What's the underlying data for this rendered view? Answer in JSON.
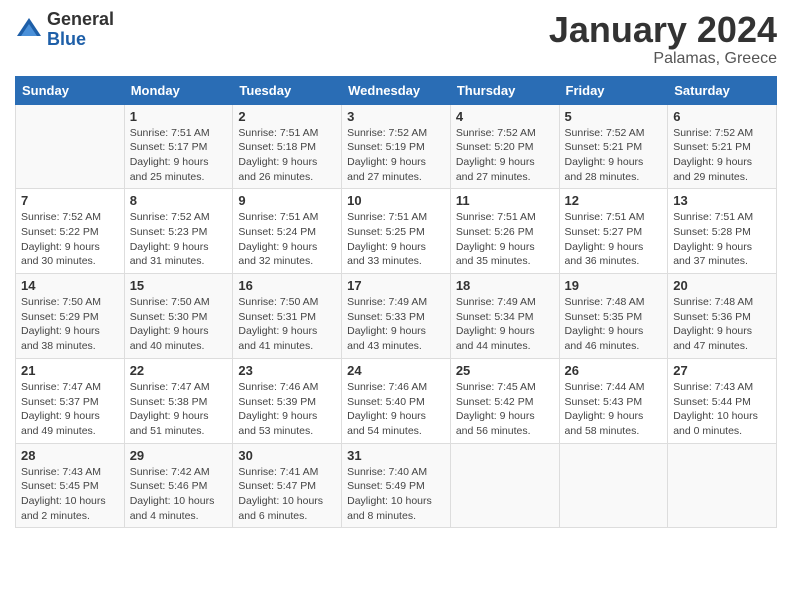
{
  "header": {
    "logo_general": "General",
    "logo_blue": "Blue",
    "month_title": "January 2024",
    "subtitle": "Palamas, Greece"
  },
  "days_of_week": [
    "Sunday",
    "Monday",
    "Tuesday",
    "Wednesday",
    "Thursday",
    "Friday",
    "Saturday"
  ],
  "weeks": [
    [
      {
        "day": "",
        "info": ""
      },
      {
        "day": "1",
        "info": "Sunrise: 7:51 AM\nSunset: 5:17 PM\nDaylight: 9 hours\nand 25 minutes."
      },
      {
        "day": "2",
        "info": "Sunrise: 7:51 AM\nSunset: 5:18 PM\nDaylight: 9 hours\nand 26 minutes."
      },
      {
        "day": "3",
        "info": "Sunrise: 7:52 AM\nSunset: 5:19 PM\nDaylight: 9 hours\nand 27 minutes."
      },
      {
        "day": "4",
        "info": "Sunrise: 7:52 AM\nSunset: 5:20 PM\nDaylight: 9 hours\nand 27 minutes."
      },
      {
        "day": "5",
        "info": "Sunrise: 7:52 AM\nSunset: 5:21 PM\nDaylight: 9 hours\nand 28 minutes."
      },
      {
        "day": "6",
        "info": "Sunrise: 7:52 AM\nSunset: 5:21 PM\nDaylight: 9 hours\nand 29 minutes."
      }
    ],
    [
      {
        "day": "7",
        "info": "Sunrise: 7:52 AM\nSunset: 5:22 PM\nDaylight: 9 hours\nand 30 minutes."
      },
      {
        "day": "8",
        "info": "Sunrise: 7:52 AM\nSunset: 5:23 PM\nDaylight: 9 hours\nand 31 minutes."
      },
      {
        "day": "9",
        "info": "Sunrise: 7:51 AM\nSunset: 5:24 PM\nDaylight: 9 hours\nand 32 minutes."
      },
      {
        "day": "10",
        "info": "Sunrise: 7:51 AM\nSunset: 5:25 PM\nDaylight: 9 hours\nand 33 minutes."
      },
      {
        "day": "11",
        "info": "Sunrise: 7:51 AM\nSunset: 5:26 PM\nDaylight: 9 hours\nand 35 minutes."
      },
      {
        "day": "12",
        "info": "Sunrise: 7:51 AM\nSunset: 5:27 PM\nDaylight: 9 hours\nand 36 minutes."
      },
      {
        "day": "13",
        "info": "Sunrise: 7:51 AM\nSunset: 5:28 PM\nDaylight: 9 hours\nand 37 minutes."
      }
    ],
    [
      {
        "day": "14",
        "info": "Sunrise: 7:50 AM\nSunset: 5:29 PM\nDaylight: 9 hours\nand 38 minutes."
      },
      {
        "day": "15",
        "info": "Sunrise: 7:50 AM\nSunset: 5:30 PM\nDaylight: 9 hours\nand 40 minutes."
      },
      {
        "day": "16",
        "info": "Sunrise: 7:50 AM\nSunset: 5:31 PM\nDaylight: 9 hours\nand 41 minutes."
      },
      {
        "day": "17",
        "info": "Sunrise: 7:49 AM\nSunset: 5:33 PM\nDaylight: 9 hours\nand 43 minutes."
      },
      {
        "day": "18",
        "info": "Sunrise: 7:49 AM\nSunset: 5:34 PM\nDaylight: 9 hours\nand 44 minutes."
      },
      {
        "day": "19",
        "info": "Sunrise: 7:48 AM\nSunset: 5:35 PM\nDaylight: 9 hours\nand 46 minutes."
      },
      {
        "day": "20",
        "info": "Sunrise: 7:48 AM\nSunset: 5:36 PM\nDaylight: 9 hours\nand 47 minutes."
      }
    ],
    [
      {
        "day": "21",
        "info": "Sunrise: 7:47 AM\nSunset: 5:37 PM\nDaylight: 9 hours\nand 49 minutes."
      },
      {
        "day": "22",
        "info": "Sunrise: 7:47 AM\nSunset: 5:38 PM\nDaylight: 9 hours\nand 51 minutes."
      },
      {
        "day": "23",
        "info": "Sunrise: 7:46 AM\nSunset: 5:39 PM\nDaylight: 9 hours\nand 53 minutes."
      },
      {
        "day": "24",
        "info": "Sunrise: 7:46 AM\nSunset: 5:40 PM\nDaylight: 9 hours\nand 54 minutes."
      },
      {
        "day": "25",
        "info": "Sunrise: 7:45 AM\nSunset: 5:42 PM\nDaylight: 9 hours\nand 56 minutes."
      },
      {
        "day": "26",
        "info": "Sunrise: 7:44 AM\nSunset: 5:43 PM\nDaylight: 9 hours\nand 58 minutes."
      },
      {
        "day": "27",
        "info": "Sunrise: 7:43 AM\nSunset: 5:44 PM\nDaylight: 10 hours\nand 0 minutes."
      }
    ],
    [
      {
        "day": "28",
        "info": "Sunrise: 7:43 AM\nSunset: 5:45 PM\nDaylight: 10 hours\nand 2 minutes."
      },
      {
        "day": "29",
        "info": "Sunrise: 7:42 AM\nSunset: 5:46 PM\nDaylight: 10 hours\nand 4 minutes."
      },
      {
        "day": "30",
        "info": "Sunrise: 7:41 AM\nSunset: 5:47 PM\nDaylight: 10 hours\nand 6 minutes."
      },
      {
        "day": "31",
        "info": "Sunrise: 7:40 AM\nSunset: 5:49 PM\nDaylight: 10 hours\nand 8 minutes."
      },
      {
        "day": "",
        "info": ""
      },
      {
        "day": "",
        "info": ""
      },
      {
        "day": "",
        "info": ""
      }
    ]
  ]
}
